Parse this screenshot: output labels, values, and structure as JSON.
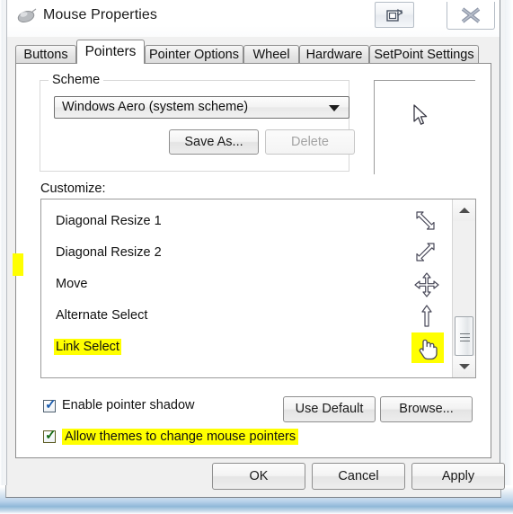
{
  "window": {
    "title": "Mouse Properties",
    "icon": "mouse-icon",
    "restore_button": "restore-window-icon",
    "close_button": "close-icon"
  },
  "tabs": [
    {
      "label": "Buttons",
      "active": false
    },
    {
      "label": "Pointers",
      "active": true
    },
    {
      "label": "Pointer Options",
      "active": false
    },
    {
      "label": "Wheel",
      "active": false
    },
    {
      "label": "Hardware",
      "active": false
    },
    {
      "label": "SetPoint Settings",
      "active": false
    }
  ],
  "scheme": {
    "group_label": "Scheme",
    "selected": "Windows Aero (system scheme)",
    "save_as_label": "Save As...",
    "delete_label": "Delete",
    "delete_disabled": true,
    "dropdown_icon": "chevron-down-icon"
  },
  "preview": {
    "cursor": "arrow-cursor"
  },
  "customize": {
    "label": "Customize:",
    "rows": [
      {
        "label": "Diagonal Resize 1",
        "cursor": "resize-nwse-cursor",
        "highlighted": false
      },
      {
        "label": "Diagonal Resize 2",
        "cursor": "resize-nesw-cursor",
        "highlighted": false
      },
      {
        "label": "Move",
        "cursor": "move-cursor",
        "highlighted": false
      },
      {
        "label": "Alternate Select",
        "cursor": "alternate-select-cursor",
        "highlighted": false
      },
      {
        "label": "Link Select",
        "cursor": "hand-cursor",
        "highlighted": true
      }
    ],
    "scrollbar": {
      "up_icon": "scroll-up-arrow-icon",
      "down_icon": "scroll-down-arrow-icon",
      "thumb": "scrollbar-thumb"
    }
  },
  "options": {
    "enable_shadow": {
      "label": "Enable pointer shadow",
      "checked": true,
      "highlighted": false
    },
    "allow_themes": {
      "label": "Allow themes to change mouse pointers",
      "checked": true,
      "highlighted": true
    },
    "use_default_label": "Use Default",
    "browse_label": "Browse..."
  },
  "footer": {
    "ok": "OK",
    "cancel": "Cancel",
    "apply": "Apply"
  },
  "colors": {
    "highlight": "#ffff00",
    "dialog_bg": "#f0f0f0",
    "panel_bg": "#ffffff",
    "text": "#111111",
    "disabled_text": "#a4a4a4"
  }
}
